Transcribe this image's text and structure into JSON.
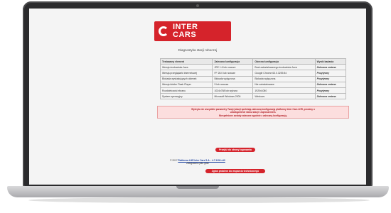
{
  "logo": {
    "line1": "INTER",
    "line2": "CARS"
  },
  "page_title": "Diagnostyka stacji roboczej",
  "table": {
    "headers": [
      "Testowany element",
      "Zalecana konfiguracja",
      "Obecna konfiguracja",
      "Wynik badania"
    ],
    "rows": [
      {
        "element": "Wersja środowiska Java",
        "recommended": "JRE 1.6 lub nowsze",
        "current": "Brak zainstalowanego środowiska Java",
        "result": "Zalecana zmiana",
        "status": "bad"
      },
      {
        "element": "Wersja przeglądarki internetowej",
        "recommended": "FF 28.0 lub nowsze",
        "current": "Google Chrome 63.0.3239.84",
        "result": "Pozytywny",
        "status": "good"
      },
      {
        "element": "Blokada wyskakujących okienek",
        "recommended": "Blokada wyłączona",
        "current": "Blokada wyłączona",
        "result": "Pozytywny",
        "status": "good"
      },
      {
        "element": "Wersja Adobe Flash Player",
        "recommended": "9 lub nowsza",
        "current": "Nie zainstalowane",
        "result": "Zalecana zmiana",
        "status": "bad"
      },
      {
        "element": "Rozdzielczość ekranu",
        "recommended": "1024x768 lub wyższa",
        "current": "1920x1080",
        "result": "Pozytywny",
        "status": "good"
      },
      {
        "element": "System operacyjny",
        "recommended": "Microsoft Windows 2000",
        "current": "Windows",
        "result": "Zalecana zmiana",
        "status": "bad"
      }
    ]
  },
  "warning": {
    "line1": "Wykryto nie wszystkie parametry Twojej stacji spełniają zalecaną konfigurację platformy Inter Cars LHR, prosimy o",
    "line2": "udostępnienie stanu stacji i zaproszeniem.",
    "line3": "Niespełnione zostały zalecane zgodnie z zalecaną konfiguracją."
  },
  "buttons": {
    "retry": "Przejdź do strony logowania",
    "report": "Zgłoś problem do wsparcia technicznego"
  },
  "footer": {
    "line1_prefix": "© 2017 ",
    "line1_link": "Platforma LHR Inter Cars S.A. - 4.7.1132-v10",
    "line2": "Zalogowano jako gość"
  },
  "colors": {
    "brand": "#d5232b",
    "ok": "#2e8b2e"
  }
}
